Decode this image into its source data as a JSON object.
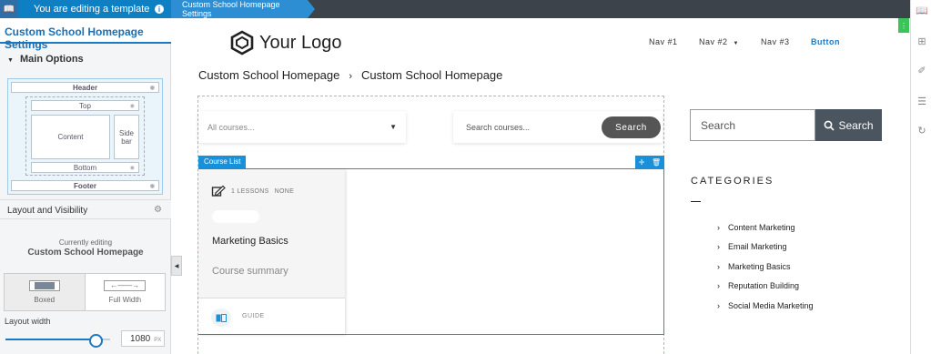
{
  "topbar": {
    "editing_label": "You are editing a template",
    "info_icon": "info-icon",
    "crumb": "Custom School Homepage Settings"
  },
  "panel": {
    "title": "Custom School Homepage Settings",
    "main_options": "Main Options",
    "diagram": {
      "header": "Header",
      "top": "Top",
      "content": "Content",
      "sidebar_line1": "Side",
      "sidebar_line2": "bar",
      "bottom": "Bottom",
      "footer": "Footer"
    },
    "layout_visibility": "Layout and Visibility",
    "currently_editing": "Currently editing",
    "current_name": "Custom School Homepage",
    "layout_options": [
      "Boxed",
      "Full Width"
    ],
    "layout_width_label": "Layout width",
    "layout_width_value": "1080",
    "layout_width_unit": "PX"
  },
  "site": {
    "logo_text": "Your Logo",
    "nav": [
      "Nav #1",
      "Nav #2",
      "Nav #3"
    ],
    "nav_button": "Button",
    "breadcrumb": [
      "Custom School Homepage",
      "Custom School Homepage"
    ],
    "courses_select": "All courses...",
    "courses_search_placeholder": "Search courses...",
    "courses_search_button": "Search",
    "course_list_tag": "Course List",
    "card": {
      "meta_lessons": "1 LESSONS",
      "meta_level": "NONE",
      "title": "Marketing Basics",
      "summary": "Course summary",
      "footer_label": "GUIDE"
    },
    "sidebar_search_placeholder": "Search",
    "sidebar_search_button": "Search",
    "categories_title": "CATEGORIES",
    "categories": [
      "Content Marketing",
      "Email Marketing",
      "Marketing Basics",
      "Reputation Building",
      "Social Media Marketing"
    ]
  },
  "colors": {
    "accent": "#1a7ac8",
    "topbar": "#3c434a",
    "green": "#3cc45a"
  }
}
